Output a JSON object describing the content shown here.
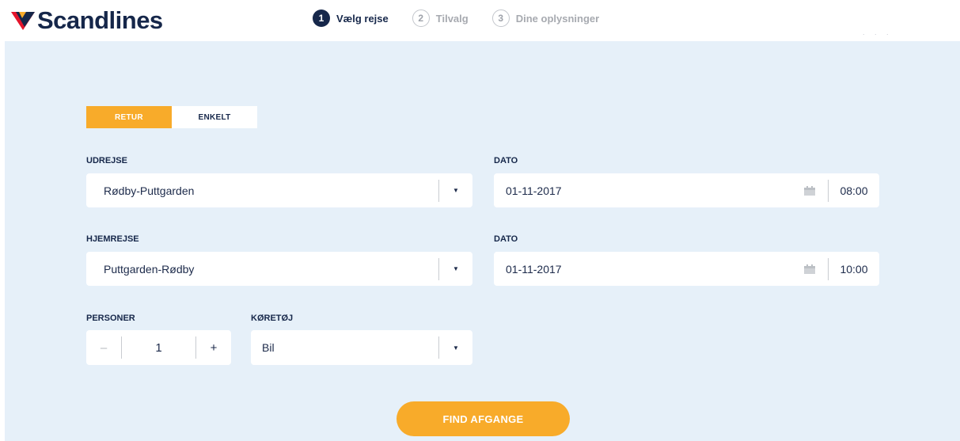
{
  "brand": {
    "name": "Scandlines",
    "colors": {
      "navy": "#16274a",
      "red": "#e4142b",
      "yellow": "#f8ab2a",
      "panel": "#e6f0f9"
    }
  },
  "steps": [
    {
      "num": "1",
      "label": "Vælg rejse",
      "active": true
    },
    {
      "num": "2",
      "label": "Tilvalg",
      "active": false
    },
    {
      "num": "3",
      "label": "Dine oplysninger",
      "active": false
    }
  ],
  "trip_type": {
    "retur": "RETUR",
    "enkelt": "ENKELT",
    "selected": "RETUR"
  },
  "outbound": {
    "label": "UDREJSE",
    "value": "Rødby-Puttgarden"
  },
  "outbound_date": {
    "label": "DATO",
    "date": "01-11-2017",
    "time": "08:00"
  },
  "return": {
    "label": "HJEMREJSE",
    "value": "Puttgarden-Rødby"
  },
  "return_date": {
    "label": "DATO",
    "date": "01-11-2017",
    "time": "10:00"
  },
  "persons": {
    "label": "PERSONER",
    "value": "1",
    "minus": "–",
    "plus": "+"
  },
  "vehicle": {
    "label": "KØRETØJ",
    "value": "Bil"
  },
  "cta": {
    "label": "FIND AFGANGE"
  },
  "icons": {
    "dropdown": "caret-down-icon",
    "calendar": "calendar-icon"
  }
}
